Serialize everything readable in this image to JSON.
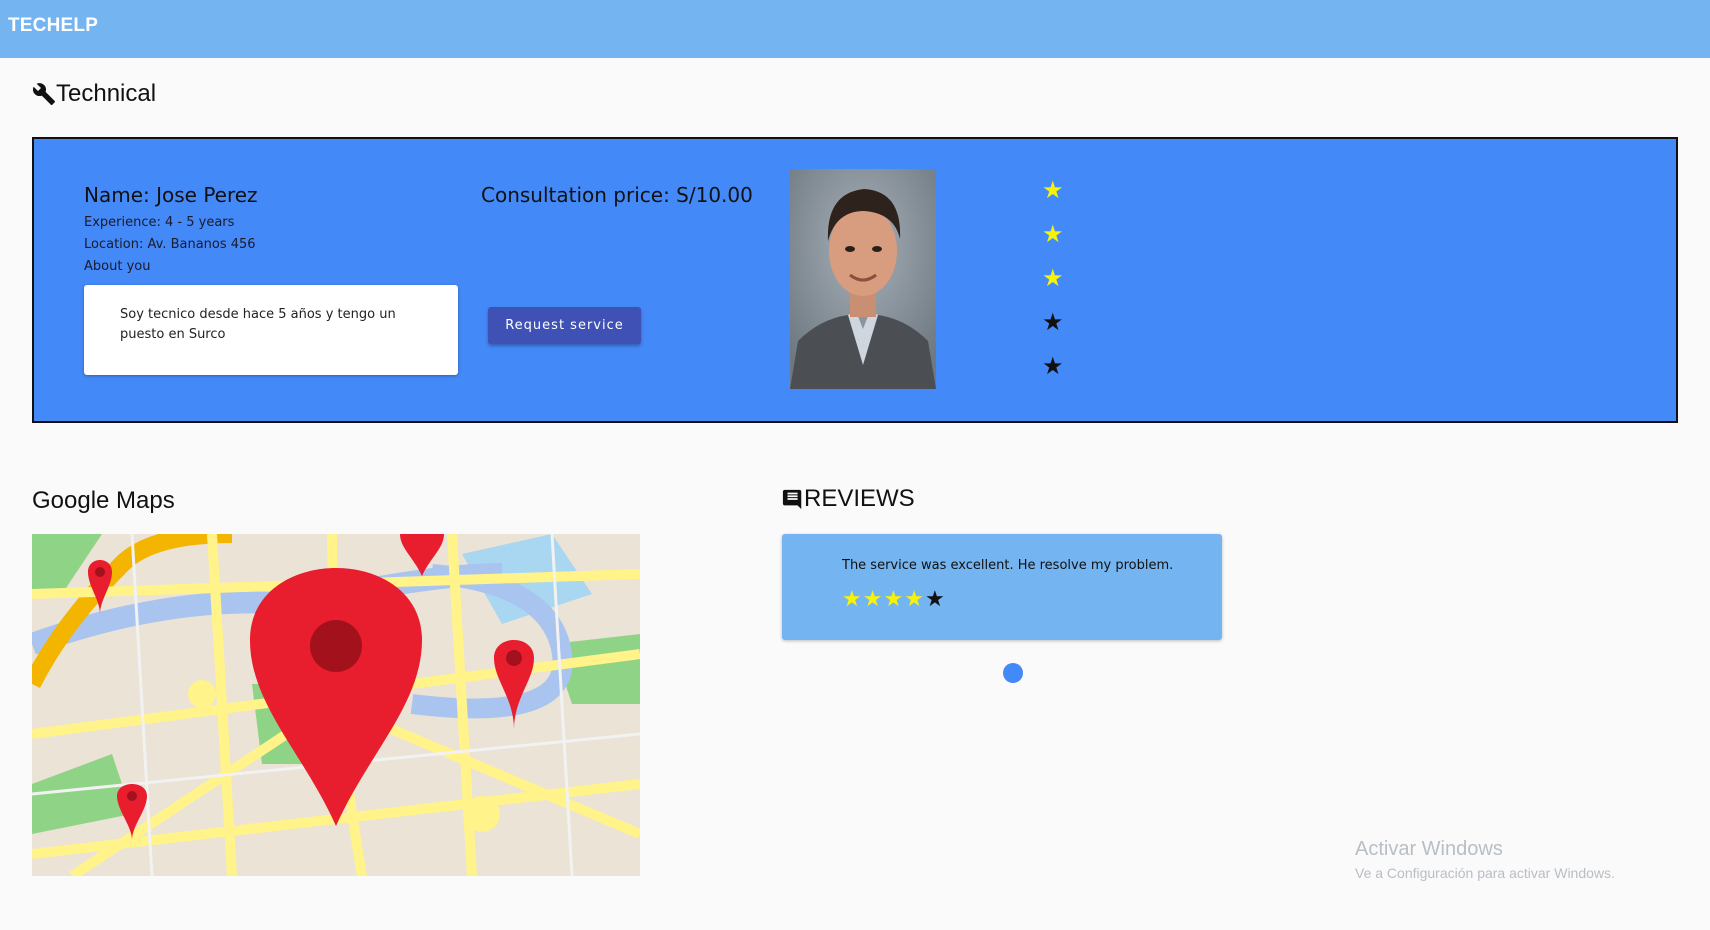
{
  "app": {
    "brand": "TECHELP"
  },
  "technical": {
    "title": "Technical",
    "icon": "wrench-icon",
    "name": "Name: Jose Perez",
    "experience": "Experience: 4 - 5 years",
    "location": "Location: Av. Bananos 456",
    "about_label": "About you",
    "about_text": "Soy tecnico desde hace 5 años y tengo un puesto en Surco",
    "price": "Consultation price: S/10.00",
    "request_button": "Request service",
    "rating": {
      "value": 3,
      "max": 5
    },
    "card_color": "#4489f8"
  },
  "maps": {
    "title": "Google Maps"
  },
  "reviews": {
    "title": "REVIEWS",
    "icon": "comment-icon",
    "items": [
      {
        "text": "The service was excellent. He resolve my problem.",
        "rating": 4,
        "max": 5
      }
    ]
  },
  "watermark": {
    "line1": "Activar Windows",
    "line2": "Ve a Configuración para activar Windows."
  },
  "colors": {
    "topbar": "#74b4f0",
    "accent": "#3f51b5",
    "star": "#f7f20a"
  }
}
